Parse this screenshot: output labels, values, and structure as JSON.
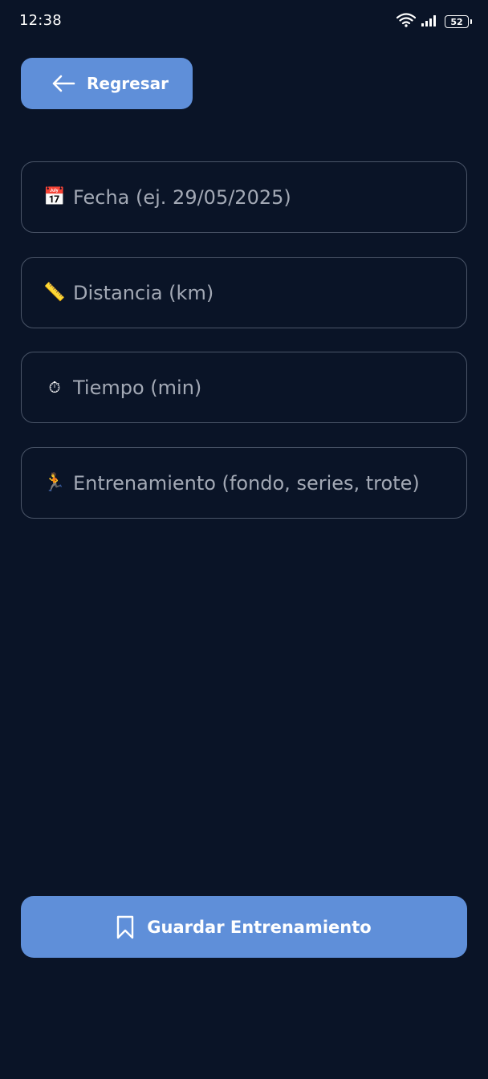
{
  "status_bar": {
    "time": "12:38",
    "battery_level": "52",
    "icons": [
      "wifi-icon",
      "signal-icon",
      "battery-icon"
    ]
  },
  "back_button": {
    "label": "Regresar",
    "icon": "arrow-left-icon"
  },
  "form": {
    "fields": [
      {
        "name": "fecha",
        "icon": "calendar-icon",
        "icon_glyph": "📅",
        "value": "",
        "placeholder": "Fecha (ej. 29/05/2025)"
      },
      {
        "name": "distancia",
        "icon": "ruler-icon",
        "icon_glyph": "📏",
        "value": "",
        "placeholder": "Distancia (km)"
      },
      {
        "name": "tiempo",
        "icon": "stopwatch-icon",
        "icon_glyph": "⏱",
        "value": "",
        "placeholder": "Tiempo (min)"
      },
      {
        "name": "entrenamiento",
        "icon": "runner-icon",
        "icon_glyph": "🏃",
        "value": "",
        "placeholder": "Entrenamiento (fondo, series, trote)"
      }
    ]
  },
  "save_button": {
    "label": "Guardar Entrenamiento",
    "icon": "bookmark-icon"
  },
  "colors": {
    "background": "#0a1427",
    "accent": "#5f8fd9",
    "field_border": "#4a5568",
    "placeholder": "#a3a9b5",
    "text": "#ffffff"
  }
}
